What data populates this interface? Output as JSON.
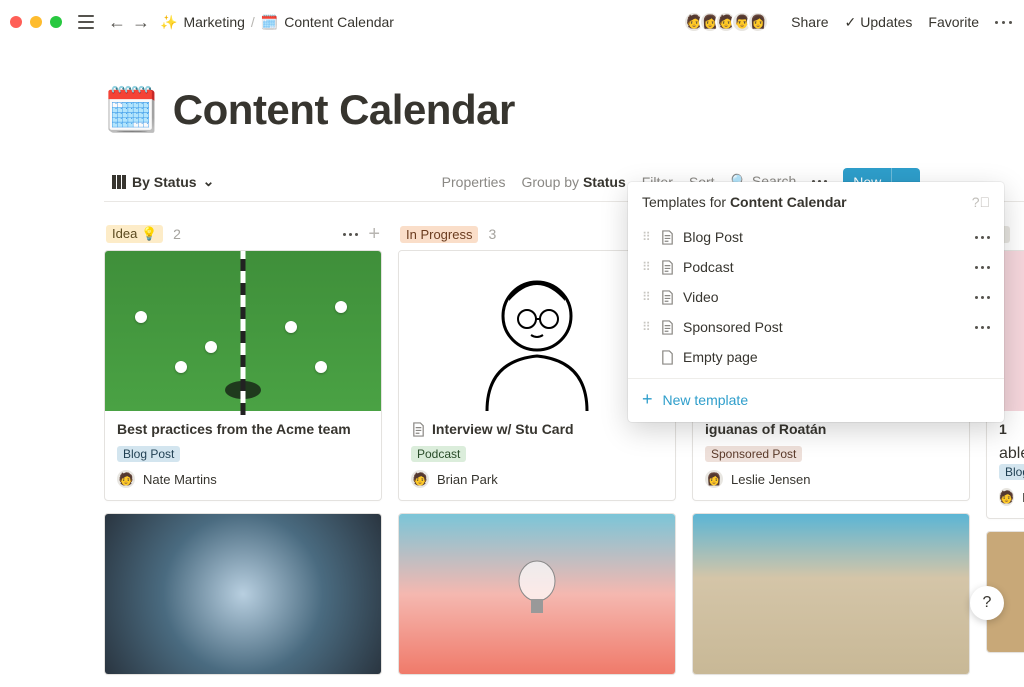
{
  "breadcrumb": {
    "parent_icon": "✨",
    "parent": "Marketing",
    "page_icon": "🗓️",
    "page": "Content Calendar"
  },
  "topbar": {
    "share": "Share",
    "updates": "Updates",
    "favorite": "Favorite"
  },
  "title": {
    "icon": "🗓️",
    "text": "Content Calendar"
  },
  "view": {
    "name": "By Status"
  },
  "view_actions": {
    "properties": "Properties",
    "group_prefix": "Group by ",
    "group_value": "Status",
    "filter": "Filter",
    "sort": "Sort",
    "search": "Search",
    "new": "New"
  },
  "columns": [
    {
      "name": "Idea",
      "emoji": "💡",
      "count": "2",
      "pill_class": "pill-yellow"
    },
    {
      "name": "In Progress",
      "emoji": "",
      "count": "3",
      "pill_class": "pill-orange"
    }
  ],
  "cards": {
    "idea1": {
      "title": "Best practices from the Acme team",
      "tag": "Blog Post",
      "tag_class": "tag-blue",
      "author": "Nate Martins"
    },
    "prog1": {
      "title": "Interview w/ Stu Card",
      "tag": "Podcast",
      "tag_class": "tag-green",
      "author": "Brian Park"
    },
    "pub1": {
      "title_line": "iguanas of Roatán",
      "tag": "Sponsored Post",
      "tag_class": "tag-brown",
      "author": "Leslie Jensen"
    },
    "pub2": {
      "title_prefix": "able",
      "tag": "Blog",
      "author_initial": "M"
    }
  },
  "popup": {
    "prefix": "Templates for ",
    "subject": "Content Calendar",
    "templates": [
      "Blog Post",
      "Podcast",
      "Video",
      "Sponsored Post"
    ],
    "empty": "Empty page",
    "new_template": "New template"
  },
  "pub_hint": "bl",
  "card_num": "1",
  "help": "?"
}
